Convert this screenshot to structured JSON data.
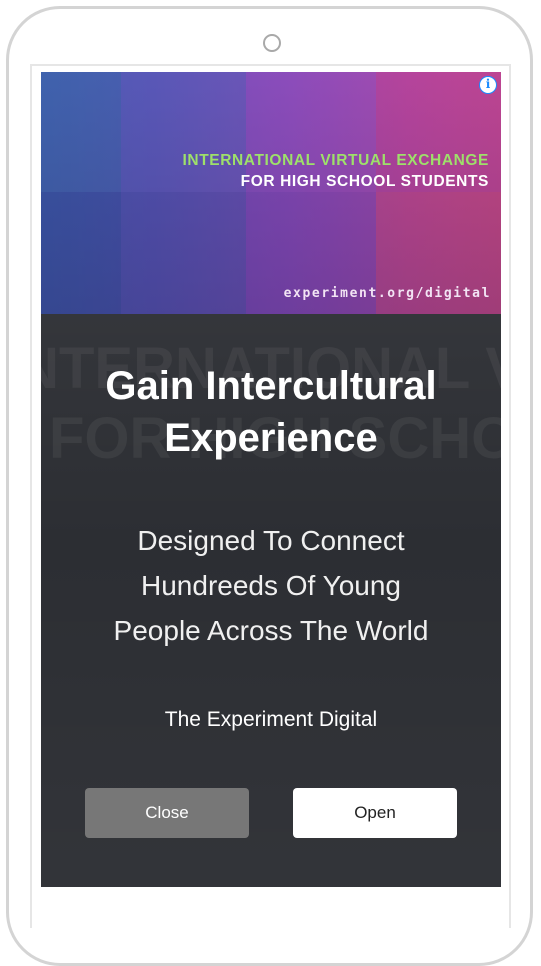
{
  "ad": {
    "banner": {
      "headline_line1": "INTERNATIONAL VIRTUAL EXCHANGE",
      "headline_line2": "FOR HIGH SCHOOL STUDENTS",
      "url": "experiment.org/digital",
      "info_icon": "i"
    },
    "headline_line1": "Gain Intercultural",
    "headline_line2": "Experience",
    "description_line1": "Designed To Connect",
    "description_line2": "Hundreeds Of Young",
    "description_line3": "People Across The World",
    "advertiser": "The Experiment Digital",
    "close_label": "Close",
    "open_label": "Open"
  },
  "colors": {
    "banner_headline_accent": "#9ee06a",
    "card_background": "#2c2e33",
    "close_button": "#777777",
    "open_button": "#ffffff",
    "info_icon": "#1a8cff"
  }
}
